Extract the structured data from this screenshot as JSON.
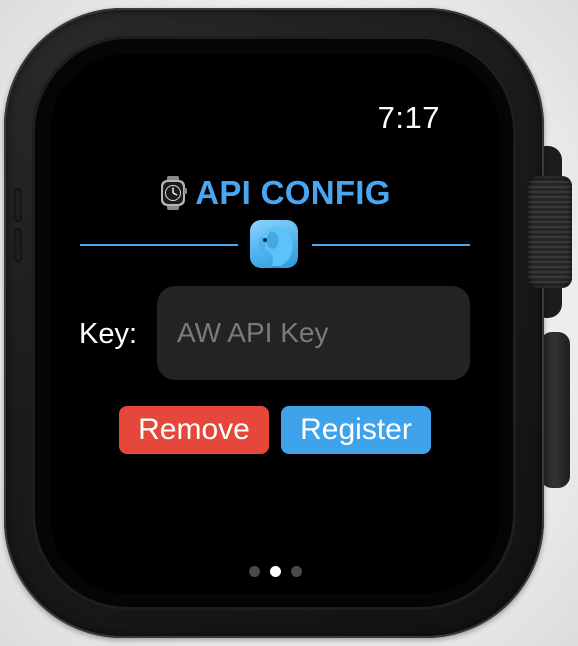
{
  "status_bar": {
    "time": "7:17"
  },
  "header": {
    "title": "API CONFIG",
    "watch_icon": "watch-icon",
    "app_icon": "elephant-app-icon",
    "accent_color": "#4aa6f0"
  },
  "form": {
    "key_label": "Key:",
    "key_placeholder": "AW API Key",
    "key_value": ""
  },
  "actions": {
    "remove_label": "Remove",
    "register_label": "Register",
    "remove_color": "#e5483a",
    "register_color": "#3fa3ec"
  },
  "pagination": {
    "pages": 3,
    "current_page": 2
  }
}
